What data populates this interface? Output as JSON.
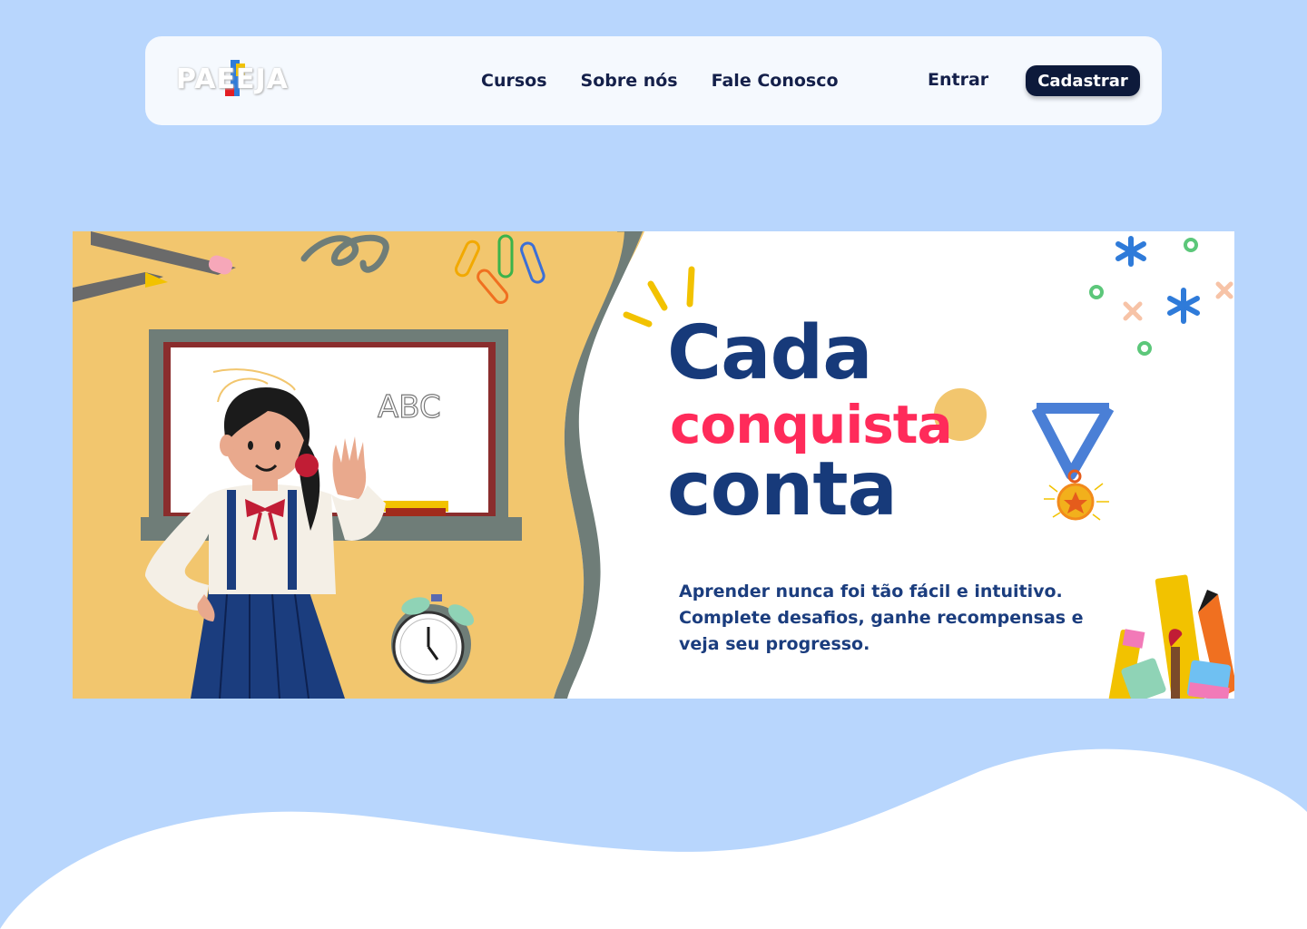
{
  "brand": {
    "logo_text": "PAEEJA"
  },
  "nav": {
    "links": [
      "Cursos",
      "Sobre nós",
      "Fale Conosco"
    ],
    "login_label": "Entrar",
    "signup_label": "Cadastrar"
  },
  "hero": {
    "title_line_1": "Cada",
    "title_line_2": "conquista",
    "title_line_3": "conta",
    "subtitle": "Aprender nunca foi tão fácil e intuitivo. Complete desafios, ganhe recompensas e veja seu progresso.",
    "blackboard_text": "ABC"
  },
  "colors": {
    "page_bg": "#b8d6fd",
    "navbar_bg": "#f5f9fe",
    "dark_navy": "#0d1a3b",
    "title_blue": "#173a7a",
    "title_pink": "#ff2b5a",
    "illustration_yellow": "#f2c66e",
    "wave_gray": "#6f7d78"
  },
  "icons": [
    "medal-icon",
    "alarm-clock-icon",
    "pencil-icon",
    "paperclip-icon",
    "sparkle-icon",
    "school-supplies-icon"
  ]
}
